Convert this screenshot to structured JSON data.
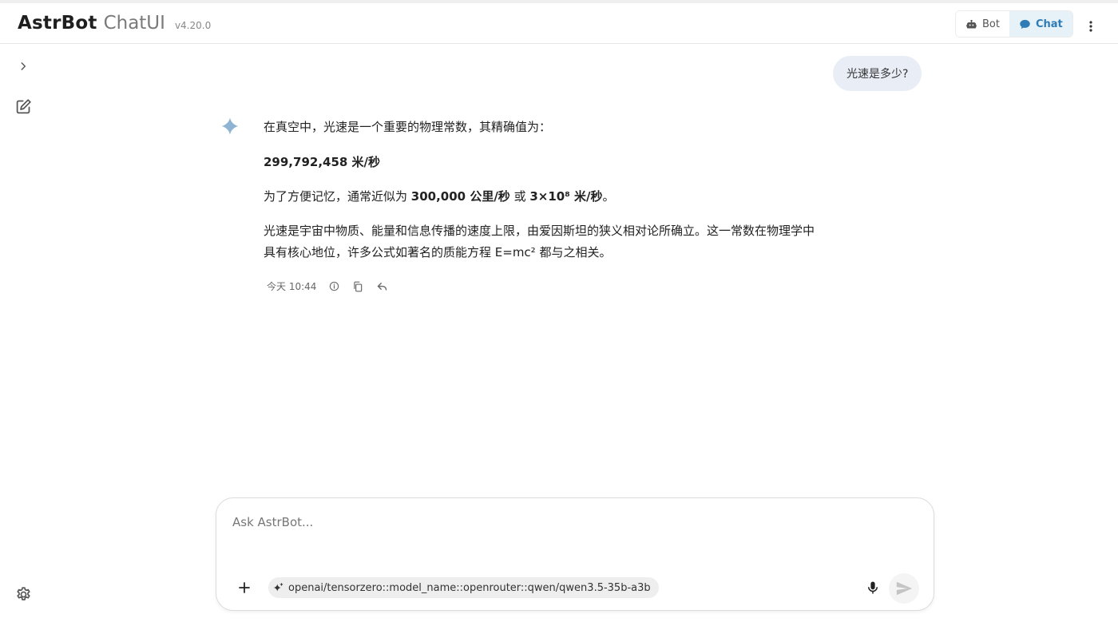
{
  "header": {
    "brand_name": "AstrBot",
    "brand_sub": "ChatUI",
    "version": "v4.20.0",
    "modes": [
      {
        "label": "Bot",
        "icon": "bot-icon",
        "active": false
      },
      {
        "label": "Chat",
        "icon": "chat-bubble-icon",
        "active": true
      }
    ]
  },
  "sidebar": {
    "expand_icon": "chevron-right-icon",
    "new_chat_icon": "edit-icon",
    "settings_icon": "gear-icon"
  },
  "conversation": {
    "user_message": "光速是多少?",
    "bot": {
      "intro": "在真空中，光速是一个重要的物理常数，其精确值为：",
      "exact_value": "299,792,458 米/秒",
      "approx_prefix": "为了方便记忆，通常近似为 ",
      "approx_value1": "300,000 公里/秒",
      "approx_or": " 或 ",
      "approx_value2": "3×10⁸ 米/秒",
      "approx_suffix": "。",
      "explanation": "光速是宇宙中物质、能量和信息传播的速度上限，由爱因斯坦的狭义相对论所确立。这一常数在物理学中具有核心地位，许多公式如著名的质能方程 E=mc² 都与之相关。",
      "timestamp": "今天 10:44"
    }
  },
  "input": {
    "placeholder": "Ask AstrBot...",
    "value": "",
    "model": "openai/tensorzero::model_name::openrouter::qwen/qwen3.5-35b-a3b"
  },
  "colors": {
    "accent": "#2e7bb5",
    "accent_bg": "#e6f1f8",
    "user_bubble": "#e9edf6",
    "sparkle": "#8fb4d3"
  }
}
